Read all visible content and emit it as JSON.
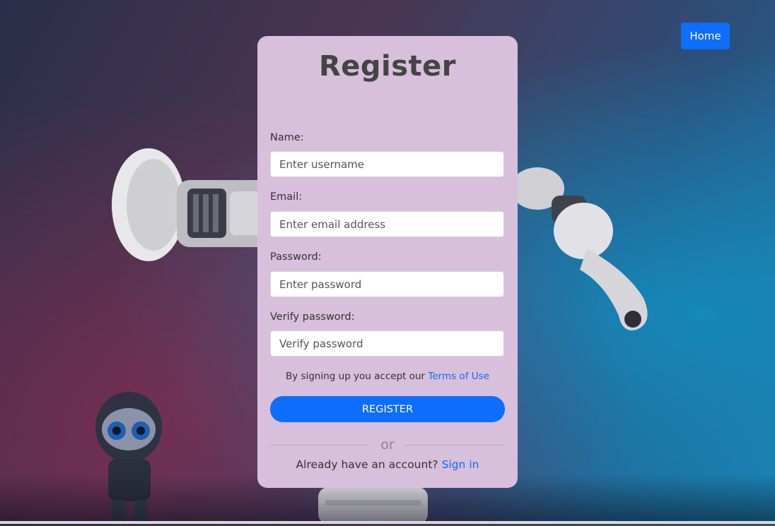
{
  "nav": {
    "home_label": "Home"
  },
  "form": {
    "title": "Register",
    "name": {
      "label": "Name:",
      "placeholder": "Enter username"
    },
    "email": {
      "label": "Email:",
      "placeholder": "Enter email address"
    },
    "password": {
      "label": "Password:",
      "placeholder": "Enter password"
    },
    "verify": {
      "label": "Verify password:",
      "placeholder": "Verify password"
    },
    "terms_prefix": "By signing up you accept our",
    "terms_link": "Terms of Use",
    "register_label": "REGISTER",
    "or_label": "or",
    "signin_prefix": "Already have an account?",
    "signin_link": "Sign in"
  },
  "colors": {
    "accent": "#0d6efd",
    "card_bg": "#d8bfdb"
  },
  "icons": [
    "robot-arm-left-image",
    "robot-arm-right-image",
    "mini-robot-image"
  ]
}
